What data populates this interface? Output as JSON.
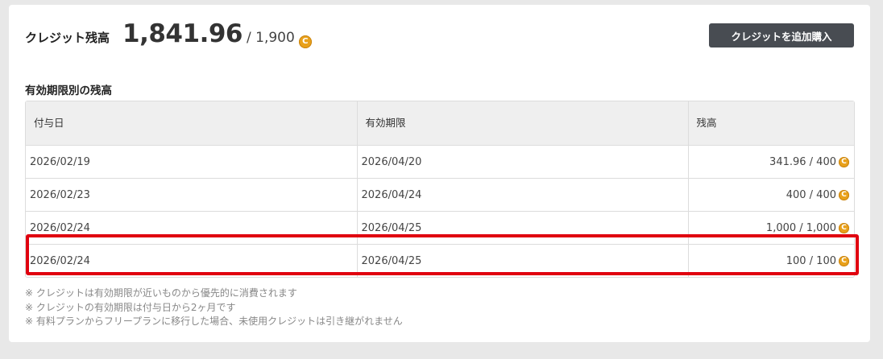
{
  "balance": {
    "label": "クレジット残高",
    "amount": "1,841.96",
    "total": "/ 1,900",
    "coin_icon": "C"
  },
  "add_button_label": "クレジットを追加購入",
  "section_title": "有効期限別の残高",
  "table": {
    "headers": [
      "付与日",
      "有効期限",
      "残高"
    ],
    "rows": [
      {
        "granted": "2026/02/19",
        "expires": "2026/04/20",
        "balance": "341.96 / 400"
      },
      {
        "granted": "2026/02/23",
        "expires": "2026/04/24",
        "balance": "400 / 400"
      },
      {
        "granted": "2026/02/24",
        "expires": "2026/04/25",
        "balance": "1,000 / 1,000"
      },
      {
        "granted": "2026/02/24",
        "expires": "2026/04/25",
        "balance": "100 / 100"
      }
    ]
  },
  "notes": [
    "※ クレジットは有効期限が近いものから優先的に消費されます",
    "※ クレジットの有効期限は付与日から2ヶ月です",
    "※ 有料プランからフリープランに移行した場合、未使用クレジットは引き継がれません"
  ],
  "colors": {
    "accent_coin": "#e9a11b",
    "button_bg": "#484c52",
    "highlight": "#e0000f"
  }
}
